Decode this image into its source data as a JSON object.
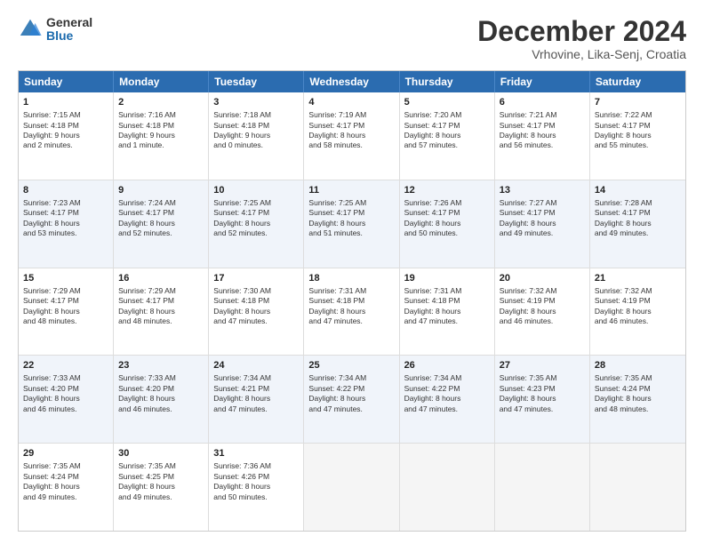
{
  "header": {
    "logo_general": "General",
    "logo_blue": "Blue",
    "month_title": "December 2024",
    "location": "Vrhovine, Lika-Senj, Croatia"
  },
  "weekdays": [
    "Sunday",
    "Monday",
    "Tuesday",
    "Wednesday",
    "Thursday",
    "Friday",
    "Saturday"
  ],
  "rows": [
    [
      {
        "day": "1",
        "info": "Sunrise: 7:15 AM\nSunset: 4:18 PM\nDaylight: 9 hours\nand 2 minutes."
      },
      {
        "day": "2",
        "info": "Sunrise: 7:16 AM\nSunset: 4:18 PM\nDaylight: 9 hours\nand 1 minute."
      },
      {
        "day": "3",
        "info": "Sunrise: 7:18 AM\nSunset: 4:18 PM\nDaylight: 9 hours\nand 0 minutes."
      },
      {
        "day": "4",
        "info": "Sunrise: 7:19 AM\nSunset: 4:17 PM\nDaylight: 8 hours\nand 58 minutes."
      },
      {
        "day": "5",
        "info": "Sunrise: 7:20 AM\nSunset: 4:17 PM\nDaylight: 8 hours\nand 57 minutes."
      },
      {
        "day": "6",
        "info": "Sunrise: 7:21 AM\nSunset: 4:17 PM\nDaylight: 8 hours\nand 56 minutes."
      },
      {
        "day": "7",
        "info": "Sunrise: 7:22 AM\nSunset: 4:17 PM\nDaylight: 8 hours\nand 55 minutes."
      }
    ],
    [
      {
        "day": "8",
        "info": "Sunrise: 7:23 AM\nSunset: 4:17 PM\nDaylight: 8 hours\nand 53 minutes."
      },
      {
        "day": "9",
        "info": "Sunrise: 7:24 AM\nSunset: 4:17 PM\nDaylight: 8 hours\nand 52 minutes."
      },
      {
        "day": "10",
        "info": "Sunrise: 7:25 AM\nSunset: 4:17 PM\nDaylight: 8 hours\nand 52 minutes."
      },
      {
        "day": "11",
        "info": "Sunrise: 7:25 AM\nSunset: 4:17 PM\nDaylight: 8 hours\nand 51 minutes."
      },
      {
        "day": "12",
        "info": "Sunrise: 7:26 AM\nSunset: 4:17 PM\nDaylight: 8 hours\nand 50 minutes."
      },
      {
        "day": "13",
        "info": "Sunrise: 7:27 AM\nSunset: 4:17 PM\nDaylight: 8 hours\nand 49 minutes."
      },
      {
        "day": "14",
        "info": "Sunrise: 7:28 AM\nSunset: 4:17 PM\nDaylight: 8 hours\nand 49 minutes."
      }
    ],
    [
      {
        "day": "15",
        "info": "Sunrise: 7:29 AM\nSunset: 4:17 PM\nDaylight: 8 hours\nand 48 minutes."
      },
      {
        "day": "16",
        "info": "Sunrise: 7:29 AM\nSunset: 4:17 PM\nDaylight: 8 hours\nand 48 minutes."
      },
      {
        "day": "17",
        "info": "Sunrise: 7:30 AM\nSunset: 4:18 PM\nDaylight: 8 hours\nand 47 minutes."
      },
      {
        "day": "18",
        "info": "Sunrise: 7:31 AM\nSunset: 4:18 PM\nDaylight: 8 hours\nand 47 minutes."
      },
      {
        "day": "19",
        "info": "Sunrise: 7:31 AM\nSunset: 4:18 PM\nDaylight: 8 hours\nand 47 minutes."
      },
      {
        "day": "20",
        "info": "Sunrise: 7:32 AM\nSunset: 4:19 PM\nDaylight: 8 hours\nand 46 minutes."
      },
      {
        "day": "21",
        "info": "Sunrise: 7:32 AM\nSunset: 4:19 PM\nDaylight: 8 hours\nand 46 minutes."
      }
    ],
    [
      {
        "day": "22",
        "info": "Sunrise: 7:33 AM\nSunset: 4:20 PM\nDaylight: 8 hours\nand 46 minutes."
      },
      {
        "day": "23",
        "info": "Sunrise: 7:33 AM\nSunset: 4:20 PM\nDaylight: 8 hours\nand 46 minutes."
      },
      {
        "day": "24",
        "info": "Sunrise: 7:34 AM\nSunset: 4:21 PM\nDaylight: 8 hours\nand 47 minutes."
      },
      {
        "day": "25",
        "info": "Sunrise: 7:34 AM\nSunset: 4:22 PM\nDaylight: 8 hours\nand 47 minutes."
      },
      {
        "day": "26",
        "info": "Sunrise: 7:34 AM\nSunset: 4:22 PM\nDaylight: 8 hours\nand 47 minutes."
      },
      {
        "day": "27",
        "info": "Sunrise: 7:35 AM\nSunset: 4:23 PM\nDaylight: 8 hours\nand 47 minutes."
      },
      {
        "day": "28",
        "info": "Sunrise: 7:35 AM\nSunset: 4:24 PM\nDaylight: 8 hours\nand 48 minutes."
      }
    ],
    [
      {
        "day": "29",
        "info": "Sunrise: 7:35 AM\nSunset: 4:24 PM\nDaylight: 8 hours\nand 49 minutes."
      },
      {
        "day": "30",
        "info": "Sunrise: 7:35 AM\nSunset: 4:25 PM\nDaylight: 8 hours\nand 49 minutes."
      },
      {
        "day": "31",
        "info": "Sunrise: 7:36 AM\nSunset: 4:26 PM\nDaylight: 8 hours\nand 50 minutes."
      },
      {
        "day": "",
        "info": ""
      },
      {
        "day": "",
        "info": ""
      },
      {
        "day": "",
        "info": ""
      },
      {
        "day": "",
        "info": ""
      }
    ]
  ]
}
